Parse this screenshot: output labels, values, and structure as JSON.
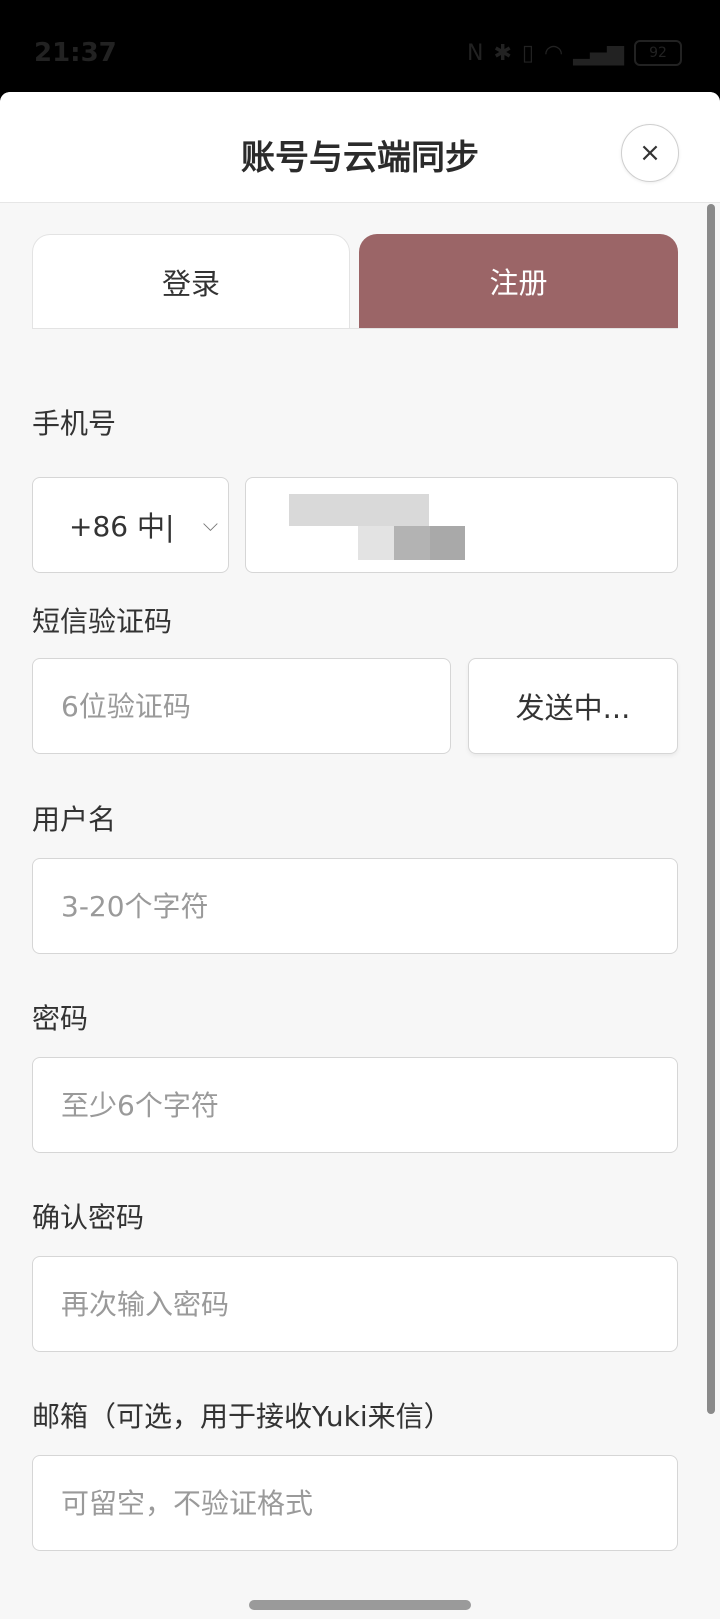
{
  "status_bar": {
    "time": "21:37",
    "battery": "92",
    "icons": [
      "nfc-icon",
      "bluetooth-icon",
      "vibrate-icon",
      "wifi-icon",
      "signal-icon"
    ]
  },
  "header": {
    "title": "账号与云端同步",
    "close_symbol": "×"
  },
  "tabs": {
    "login": "登录",
    "register": "注册",
    "active": "register"
  },
  "form": {
    "phone_label": "手机号",
    "country_code": "+86 中|",
    "sms_label": "短信验证码",
    "sms_placeholder": "6位验证码",
    "send_button": "发送中...",
    "username_label": "用户名",
    "username_placeholder": "3-20个字符",
    "password_label": "密码",
    "password_placeholder": "至少6个字符",
    "confirm_label": "确认密码",
    "confirm_placeholder": "再次输入密码",
    "email_label": "邮箱（可选，用于接收Yuki来信）",
    "email_placeholder": "可留空，不验证格式"
  },
  "colors": {
    "accent": "#9b6567",
    "background": "#f7f7f7"
  }
}
